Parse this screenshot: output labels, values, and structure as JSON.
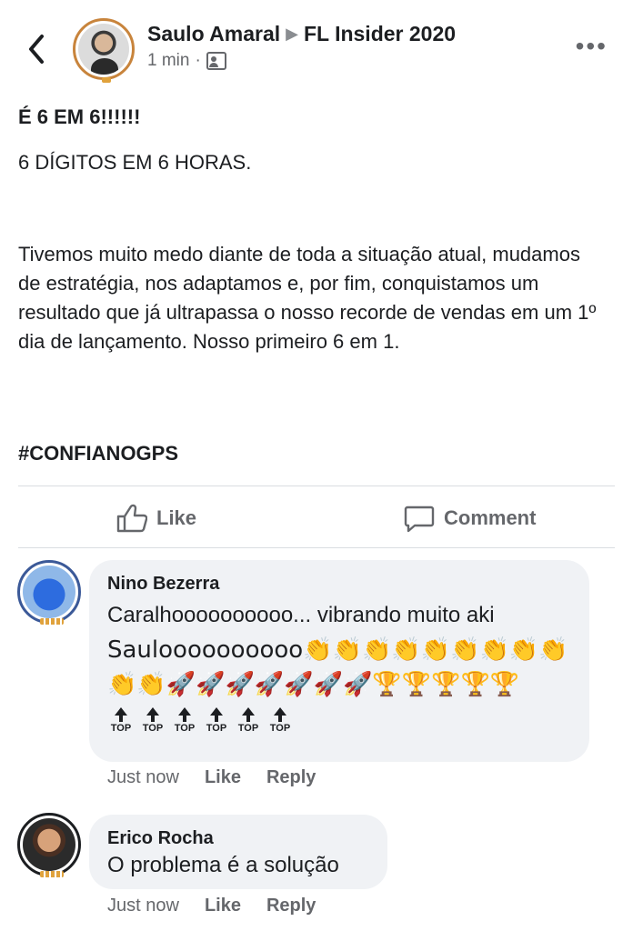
{
  "header": {
    "author": "Saulo Amaral",
    "group": "FL Insider 2020",
    "time": "1 min",
    "separator": "·"
  },
  "post": {
    "title": "É 6 EM 6!!!!!!",
    "subtitle": "6 DÍGITOS EM 6 HORAS.",
    "body": "Tivemos muito medo diante de toda a situação atual, mudamos de estratégia, nos adaptamos e, por fim, conquistamos um resultado que já ultrapassa o nosso recorde de vendas em um 1º dia de lançamento. Nosso primeiro 6 em 1.",
    "hashtag": "#CONFIANOGPS"
  },
  "actions": {
    "like_label": "Like",
    "comment_label": "Comment"
  },
  "comments": [
    {
      "name": "Nino Bezerra",
      "line1": "Caralhoooooooooo... vibrando muito aki",
      "line2": "Sauloooooooooo👏👏👏👏👏👏👏👏👏",
      "line3": "👏👏🚀🚀🚀🚀🚀🚀🚀🏆🏆🏆🏆🏆",
      "top_badges": [
        "TOP",
        "TOP",
        "TOP",
        "TOP",
        "TOP",
        "TOP"
      ],
      "time": "Just now",
      "like": "Like",
      "reply": "Reply"
    },
    {
      "name": "Erico Rocha",
      "line1": "O problema é a solução",
      "time": "Just now",
      "like": "Like",
      "reply": "Reply"
    }
  ],
  "colors": {
    "accent_ring": "#c8843c",
    "muted_text": "#65676b",
    "bubble_bg": "#f0f2f5"
  }
}
